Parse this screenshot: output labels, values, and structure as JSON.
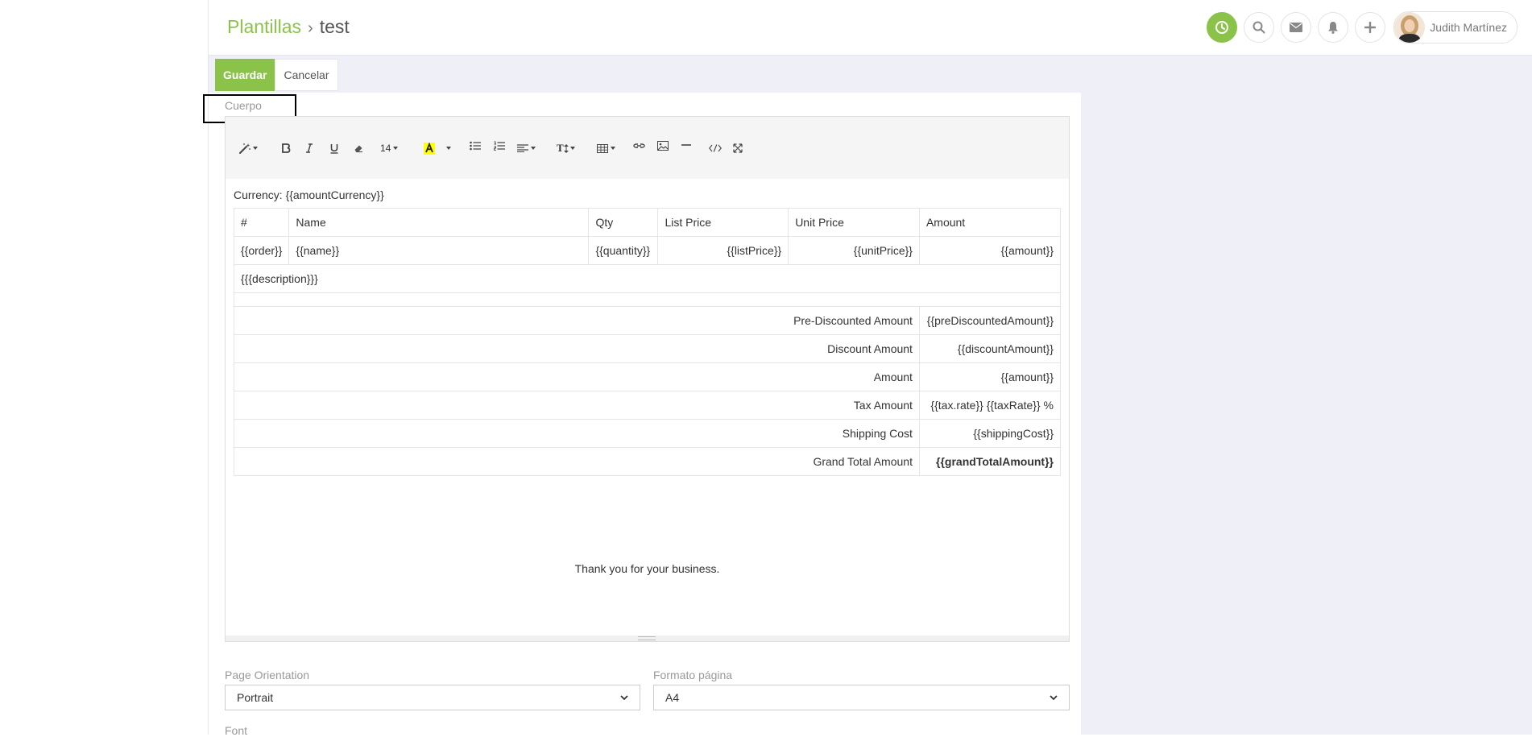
{
  "breadcrumb": {
    "section": "Plantillas",
    "separator": "›",
    "current": "test"
  },
  "user": {
    "name": "Judith Martínez"
  },
  "buttons": {
    "save": "Guardar",
    "cancel": "Cancelar"
  },
  "body_label": "Cuerpo",
  "toolbar": {
    "font_size": "14",
    "font_size_label": "T"
  },
  "content": {
    "currency_line": "Currency: {{amountCurrency}}",
    "headers": [
      "#",
      "Name",
      "Qty",
      "List Price",
      "Unit Price",
      "Amount"
    ],
    "item_row": [
      "{{order}}",
      "{{name}}",
      "{{quantity}}",
      "{{listPrice}}",
      "{{unitPrice}}",
      "{{amount}}"
    ],
    "description": "{{{description}}}",
    "totals": [
      {
        "label": "Pre-Discounted Amount",
        "value": "{{preDiscountedAmount}}"
      },
      {
        "label": "Discount Amount",
        "value": "{{discountAmount}}"
      },
      {
        "label": "Amount",
        "value": "{{amount}}"
      },
      {
        "label": "Tax Amount",
        "value": "{{tax.rate}} {{taxRate}} %"
      },
      {
        "label": "Shipping Cost",
        "value": "{{shippingCost}}"
      },
      {
        "label": "Grand Total Amount",
        "value": "{{grandTotalAmount}}"
      }
    ],
    "thanks": "Thank you for your business."
  },
  "fields": {
    "page_orientation": {
      "label": "Page Orientation",
      "value": "Portrait"
    },
    "page_format": {
      "label": "Formato página",
      "value": "A4"
    },
    "font": {
      "label": "Font"
    }
  },
  "colors": {
    "accent": "#8bc34a"
  }
}
